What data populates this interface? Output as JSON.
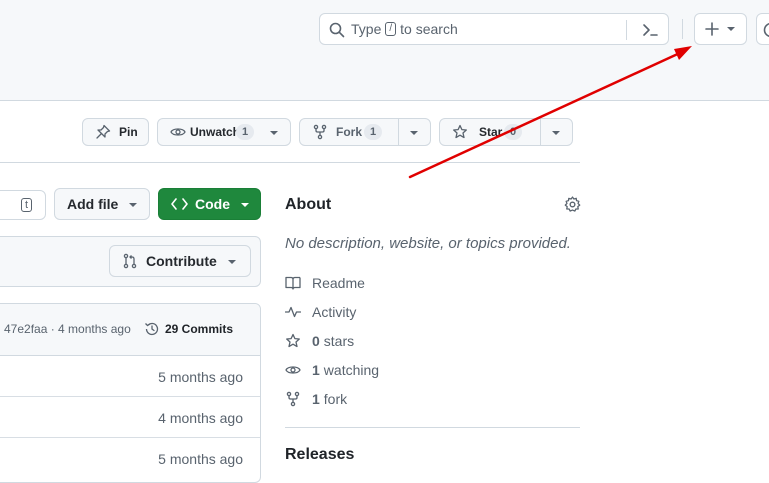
{
  "header": {
    "search_placeholder_pre": "Type",
    "search_key": "/",
    "search_placeholder_post": "to search"
  },
  "repo_actions": {
    "pin_label": "Pin",
    "unwatch_label": "Unwatch",
    "unwatch_count": "1",
    "fork_label": "Fork",
    "fork_count": "1",
    "star_label": "Star",
    "star_count": "0"
  },
  "file_toolbar": {
    "go_to_file_key": "t",
    "add_file_label": "Add file",
    "code_label": "Code",
    "contribute_label": "Contribute"
  },
  "commit_bar": {
    "commit_info": "47e2faa · 4 months ago",
    "commits_label": "29 Commits"
  },
  "file_rows": [
    {
      "time": "5 months ago"
    },
    {
      "time": "4 months ago"
    },
    {
      "time": "5 months ago"
    }
  ],
  "about": {
    "title": "About",
    "description": "No description, website, or topics provided.",
    "readme": "Readme",
    "activity": "Activity",
    "stars_count": "0",
    "stars_label": "stars",
    "watching_count": "1",
    "watching_label": "watching",
    "fork_count": "1",
    "fork_label": "fork",
    "releases_title": "Releases"
  },
  "colors": {
    "code_button": "#1f883d",
    "annotation_arrow": "#e00000"
  }
}
